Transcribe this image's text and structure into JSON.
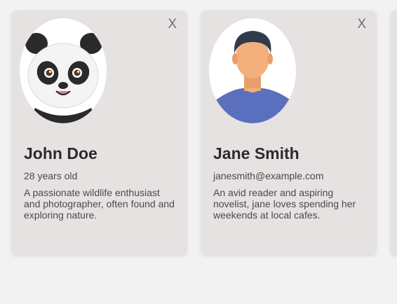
{
  "cards": [
    {
      "close_label": "X",
      "avatar_icon": "panda-avatar-icon",
      "name": "John Doe",
      "meta": "28 years old",
      "description": "A passionate wildlife enthusiast and photographer, often found and exploring nature."
    },
    {
      "close_label": "X",
      "avatar_icon": "man-avatar-icon",
      "name": "Jane Smith",
      "meta": "janesmith@example.com",
      "description": "An avid reader and aspiring novelist, jane loves spending her weekends at local cafes."
    }
  ],
  "colors": {
    "page_bg": "#f3f2f2",
    "card_bg": "#e6e2e1",
    "name_text": "#2b2b2b",
    "body_text": "#4a4a4a"
  }
}
